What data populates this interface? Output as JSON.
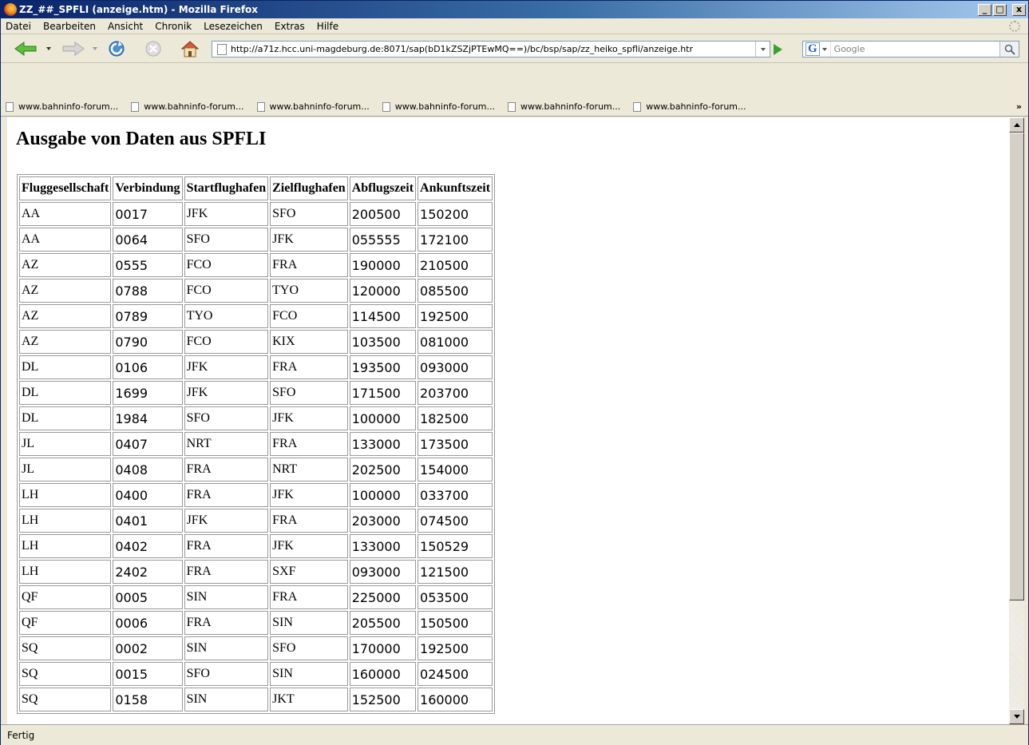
{
  "window": {
    "title": "ZZ_##_SPFLI (anzeige.htm) - Mozilla Firefox",
    "controls": [
      "_",
      "□",
      "x"
    ]
  },
  "menu": [
    "Datei",
    "Bearbeiten",
    "Ansicht",
    "Chronik",
    "Lesezeichen",
    "Extras",
    "Hilfe"
  ],
  "nav": {
    "icons": [
      "back-arrow-icon",
      "forward-arrow-icon",
      "reload-icon",
      "stop-icon",
      "home-icon",
      "go-icon"
    ],
    "url": "http://a71z.hcc.uni-magdeburg.de:8071/sap(bD1kZSZjPTEwMQ==)/bc/bsp/sap/zz_heiko_spfli/anzeige.htr",
    "search_engine": "G",
    "search_placeholder": "Google"
  },
  "bookmarks": [
    "www.bahninfo-forum...",
    "www.bahninfo-forum...",
    "www.bahninfo-forum...",
    "www.bahninfo-forum...",
    "www.bahninfo-forum...",
    "www.bahninfo-forum..."
  ],
  "bookmarks_overflow": "»",
  "page": {
    "heading": "Ausgabe von Daten aus SPFLI",
    "table": {
      "headers": [
        "Fluggesellschaft",
        "Verbindung",
        "Startflughafen",
        "Zielflughafen",
        "Abflugszeit",
        "Ankunftszeit"
      ],
      "rows": [
        [
          "AA",
          "0017",
          "JFK",
          "SFO",
          "200500",
          "150200"
        ],
        [
          "AA",
          "0064",
          "SFO",
          "JFK",
          "055555",
          "172100"
        ],
        [
          "AZ",
          "0555",
          "FCO",
          "FRA",
          "190000",
          "210500"
        ],
        [
          "AZ",
          "0788",
          "FCO",
          "TYO",
          "120000",
          "085500"
        ],
        [
          "AZ",
          "0789",
          "TYO",
          "FCO",
          "114500",
          "192500"
        ],
        [
          "AZ",
          "0790",
          "FCO",
          "KIX",
          "103500",
          "081000"
        ],
        [
          "DL",
          "0106",
          "JFK",
          "FRA",
          "193500",
          "093000"
        ],
        [
          "DL",
          "1699",
          "JFK",
          "SFO",
          "171500",
          "203700"
        ],
        [
          "DL",
          "1984",
          "SFO",
          "JFK",
          "100000",
          "182500"
        ],
        [
          "JL",
          "0407",
          "NRT",
          "FRA",
          "133000",
          "173500"
        ],
        [
          "JL",
          "0408",
          "FRA",
          "NRT",
          "202500",
          "154000"
        ],
        [
          "LH",
          "0400",
          "FRA",
          "JFK",
          "100000",
          "033700"
        ],
        [
          "LH",
          "0401",
          "JFK",
          "FRA",
          "203000",
          "074500"
        ],
        [
          "LH",
          "0402",
          "FRA",
          "JFK",
          "133000",
          "150529"
        ],
        [
          "LH",
          "2402",
          "FRA",
          "SXF",
          "093000",
          "121500"
        ],
        [
          "QF",
          "0005",
          "SIN",
          "FRA",
          "225000",
          "053500"
        ],
        [
          "QF",
          "0006",
          "FRA",
          "SIN",
          "205500",
          "150500"
        ],
        [
          "SQ",
          "0002",
          "SIN",
          "SFO",
          "170000",
          "192500"
        ],
        [
          "SQ",
          "0015",
          "SFO",
          "SIN",
          "160000",
          "024500"
        ],
        [
          "SQ",
          "0158",
          "SIN",
          "JKT",
          "152500",
          "160000"
        ]
      ]
    }
  },
  "status": "Fertig",
  "colors": {
    "titlebar_start": "#0a246a",
    "titlebar_end": "#a6caf0",
    "chrome": "#ece9d8",
    "go_green": "#3aa02e"
  }
}
